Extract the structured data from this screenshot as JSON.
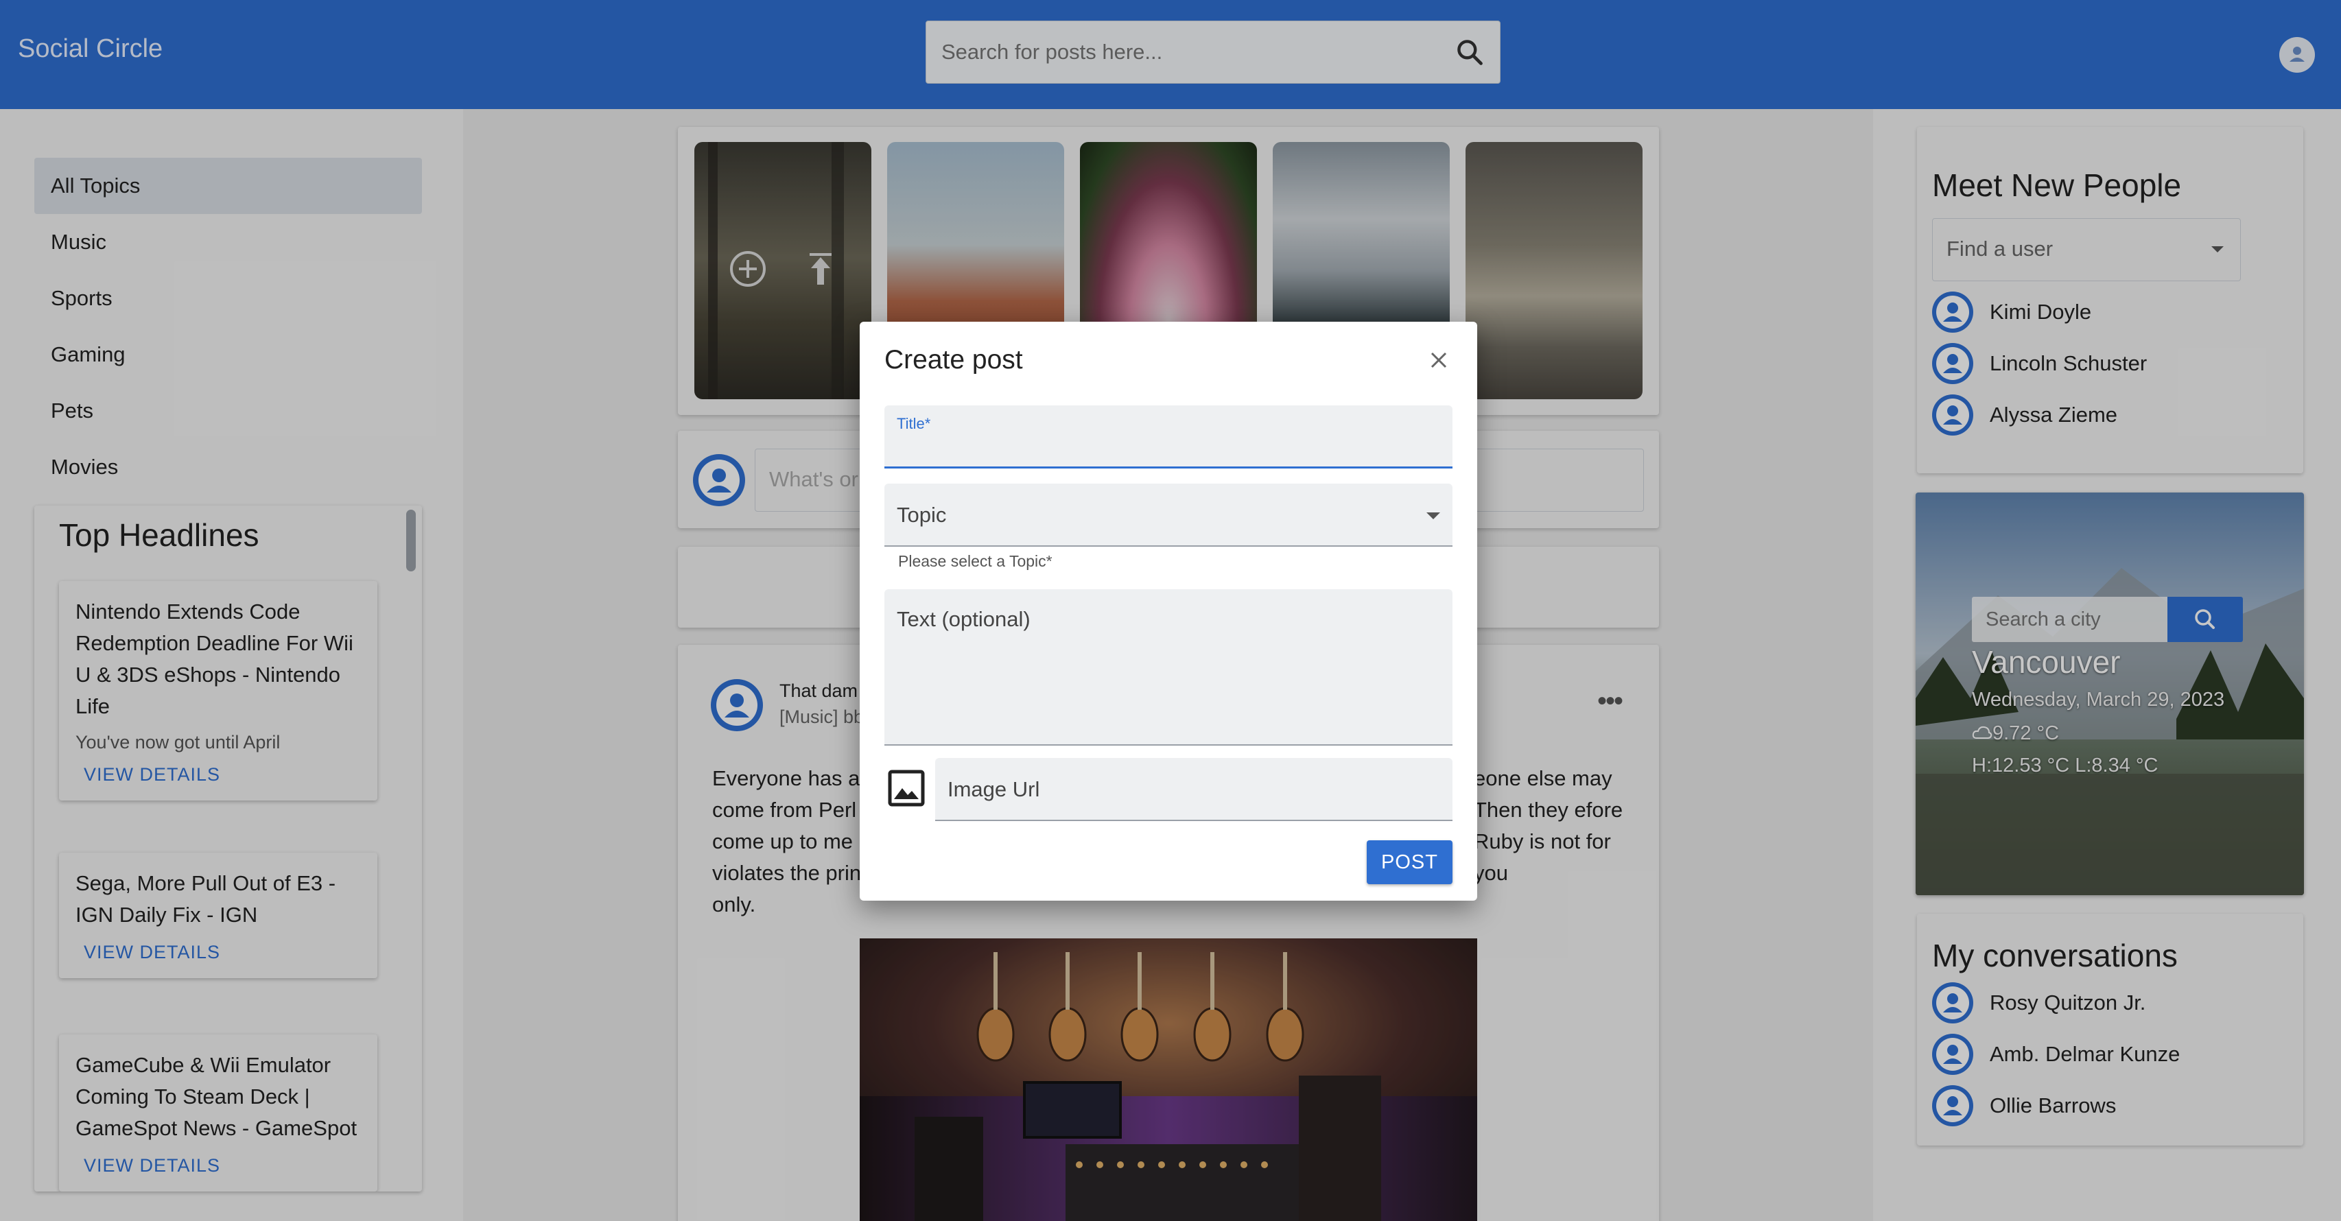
{
  "app": {
    "title": "Social Circle"
  },
  "search": {
    "placeholder": "Search for posts here..."
  },
  "sidebar": {
    "topics": [
      "All Topics",
      "Music",
      "Sports",
      "Gaming",
      "Pets",
      "Movies"
    ],
    "active_topic": "All Topics"
  },
  "headlines": {
    "title": "Top Headlines",
    "items": [
      {
        "title": "Nintendo Extends Code Redemption Deadline For Wii U & 3DS eShops - Nintendo Life",
        "subtitle": "You've now got until April",
        "link": "VIEW DETAILS"
      },
      {
        "title": "Sega, More Pull Out of E3 - IGN Daily Fix - IGN",
        "subtitle": "",
        "link": "VIEW DETAILS"
      },
      {
        "title": "GameCube & Wii Emulator Coming To Steam Deck | GameSpot News - GameSpot",
        "subtitle": "",
        "link": "VIEW DETAILS"
      }
    ]
  },
  "composer": {
    "placeholder": "What's or"
  },
  "post": {
    "title_partial": "That dam",
    "meta_partial": "[Music] bb",
    "body_left": "Everyone has a come from Perl come up to me violates the prin only.",
    "body_right": "eone else may Then they efore Ruby is not for you"
  },
  "meet": {
    "title": "Meet New People",
    "find_placeholder": "Find a user",
    "people": [
      "Kimi Doyle",
      "Lincoln Schuster",
      "Alyssa Zieme"
    ]
  },
  "weather": {
    "search_placeholder": "Search a city",
    "city": "Vancouver",
    "date": "Wednesday, March 29, 2023",
    "temp": "9.72 °C",
    "high_low": "H:12.53 °C L:8.34 °C"
  },
  "conversations": {
    "title": "My conversations",
    "people": [
      "Rosy Quitzon Jr.",
      "Amb. Delmar Kunze",
      "Ollie Barrows"
    ]
  },
  "modal": {
    "title": "Create post",
    "title_label": "Title*",
    "topic_label": "Topic",
    "topic_helper": "Please select a Topic*",
    "text_label": "Text (optional)",
    "image_label": "Image Url",
    "submit_label": "POST"
  },
  "colors": {
    "primary": "#2f6fd1",
    "background": "#f3f3f3"
  }
}
